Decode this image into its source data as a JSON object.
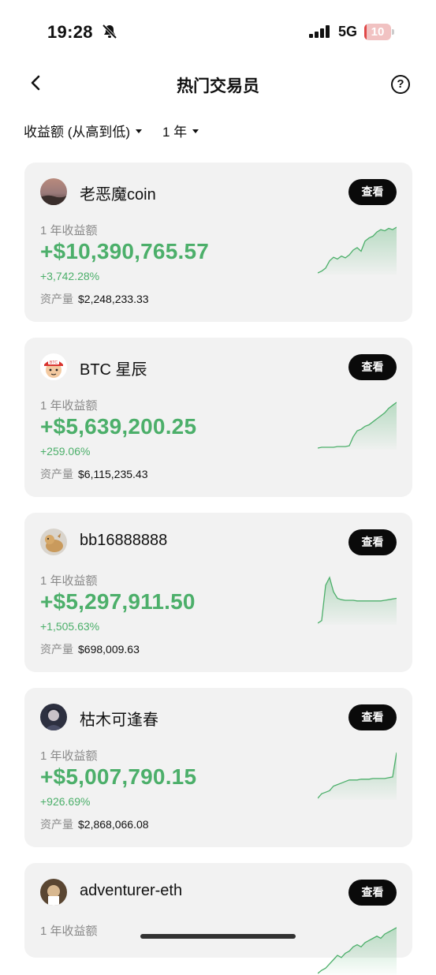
{
  "status": {
    "time": "19:28",
    "network": "5G",
    "battery": "10",
    "battery_level": 0.1,
    "battery_color": "#e04848"
  },
  "nav": {
    "back_icon": "chevron-left-icon",
    "title": "热门交易员",
    "help_icon": "question-circle-icon",
    "help_glyph": "?"
  },
  "filters": {
    "sort_label": "收益额 (从高到低)",
    "period_label": "1 年"
  },
  "colors": {
    "profit": "#4caf6a",
    "card_bg": "#f2f2f2",
    "button_bg": "#0a0a0a"
  },
  "traders": [
    {
      "name": "老恶魔coin",
      "button": "查看",
      "period_label": "1 年收益额",
      "profit": "+$10,390,765.57",
      "percent": "+3,742.28%",
      "assets_label": "资产量",
      "assets": "$2,248,233.33",
      "spark": [
        2,
        5,
        10,
        22,
        28,
        25,
        30,
        27,
        32,
        40,
        44,
        38,
        55,
        60,
        63,
        70,
        74,
        72,
        76,
        74,
        78
      ]
    },
    {
      "name": "BTC 星辰",
      "button": "查看",
      "period_label": "1 年收益额",
      "profit": "+$5,639,200.25",
      "percent": "+259.06%",
      "assets_label": "资产量",
      "assets": "$6,115,235.43",
      "spark": [
        5,
        6,
        6,
        6,
        6,
        7,
        7,
        7,
        8,
        20,
        28,
        30,
        34,
        36,
        40,
        44,
        48,
        52,
        58,
        62,
        66
      ]
    },
    {
      "name": "bb16888888",
      "button": "查看",
      "period_label": "1 年收益额",
      "profit": "+$5,297,911.50",
      "percent": "+1,505.63%",
      "assets_label": "资产量",
      "assets": "$698,009.63",
      "spark": [
        2,
        6,
        60,
        72,
        50,
        40,
        38,
        37,
        37,
        37,
        36,
        36,
        36,
        36,
        36,
        36,
        36,
        37,
        38,
        39,
        40
      ]
    },
    {
      "name": "枯木可逢春",
      "button": "查看",
      "period_label": "1 年收益额",
      "profit": "+$5,007,790.15",
      "percent": "+926.69%",
      "assets_label": "资产量",
      "assets": "$2,868,066.08",
      "spark": [
        2,
        8,
        10,
        12,
        18,
        20,
        22,
        24,
        26,
        26,
        26,
        27,
        27,
        27,
        28,
        28,
        28,
        28,
        29,
        30,
        62
      ]
    },
    {
      "name": "adventurer-eth",
      "button": "查看",
      "period_label": "1 年收益额",
      "profit": "",
      "percent": "",
      "assets_label": "",
      "assets": "",
      "spark": [
        5,
        8,
        10,
        14,
        18,
        22,
        20,
        24,
        26,
        30,
        32,
        30,
        34,
        36,
        38,
        40,
        38,
        42,
        44,
        46,
        48
      ]
    }
  ]
}
